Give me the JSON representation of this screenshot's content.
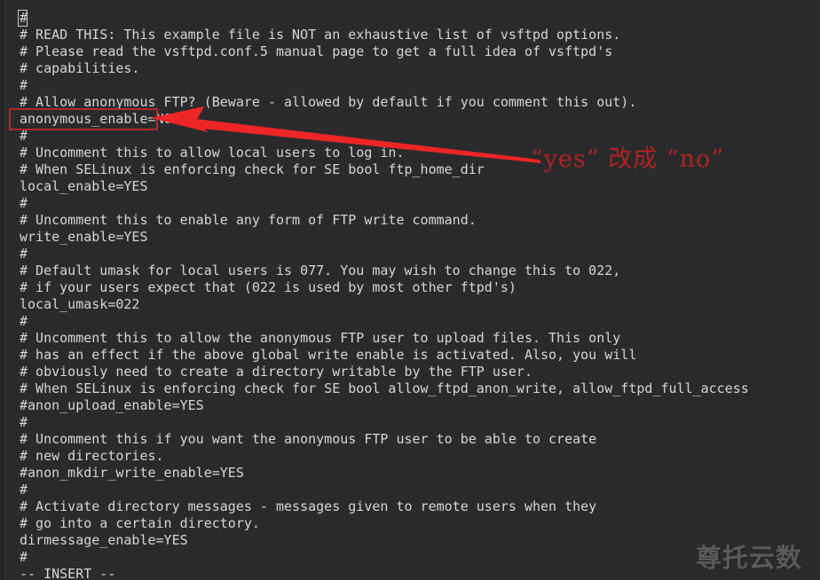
{
  "editor": {
    "mode_status": "-- INSERT --",
    "cursor_line": 1,
    "background_color": "#2b2b2d",
    "text_color": "#d6d6d6",
    "lines": [
      "#",
      "# READ THIS: This example file is NOT an exhaustive list of vsftpd options.",
      "# Please read the vsftpd.conf.5 manual page to get a full idea of vsftpd's",
      "# capabilities.",
      "#",
      "# Allow anonymous FTP? (Beware - allowed by default if you comment this out).",
      "anonymous_enable=NO",
      "#",
      "# Uncomment this to allow local users to log in.",
      "# When SELinux is enforcing check for SE bool ftp_home_dir",
      "local_enable=YES",
      "#",
      "# Uncomment this to enable any form of FTP write command.",
      "write_enable=YES",
      "#",
      "# Default umask for local users is 077. You may wish to change this to 022,",
      "# if your users expect that (022 is used by most other ftpd's)",
      "local_umask=022",
      "#",
      "# Uncomment this to allow the anonymous FTP user to upload files. This only",
      "# has an effect if the above global write enable is activated. Also, you will",
      "# obviously need to create a directory writable by the FTP user.",
      "# When SELinux is enforcing check for SE bool allow_ftpd_anon_write, allow_ftpd_full_access",
      "#anon_upload_enable=YES",
      "#",
      "# Uncomment this if you want the anonymous FTP user to be able to create",
      "# new directories.",
      "#anon_mkdir_write_enable=YES",
      "#",
      "# Activate directory messages - messages given to remote users when they",
      "# go into a certain directory.",
      "dirmessage_enable=YES",
      "#"
    ]
  },
  "annotation": {
    "text": "“yes” 改成 “no”",
    "color": "#b22222",
    "highlight_target": "anonymous_enable=NO",
    "highlight_border_color": "#b32a2a",
    "arrow_color": "#ee2626"
  },
  "watermark": {
    "text": "尊托云数",
    "color": "#5b5b5d"
  }
}
